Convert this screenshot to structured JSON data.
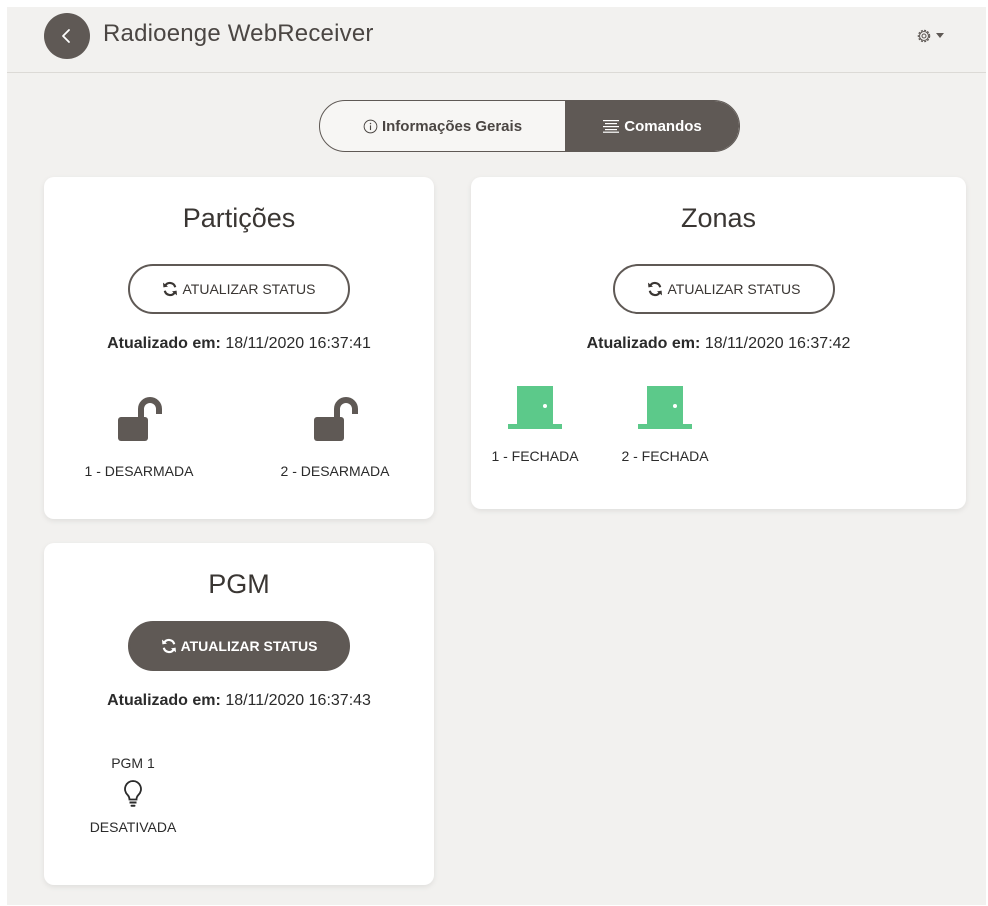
{
  "app": {
    "title": "Radioenge WebReceiver"
  },
  "tabs": [
    {
      "label": "Informações Gerais",
      "active": false
    },
    {
      "label": "Comandos",
      "active": true
    }
  ],
  "particoes": {
    "title": "Partições",
    "refresh_label": "ATUALIZAR STATUS",
    "updated_label": "Atualizado em:",
    "updated_value": "18/11/2020 16:37:41",
    "items": [
      {
        "label": "1 - DESARMADA",
        "icon": "lock-open-icon"
      },
      {
        "label": "2 - DESARMADA",
        "icon": "lock-open-icon"
      }
    ]
  },
  "zonas": {
    "title": "Zonas",
    "refresh_label": "ATUALIZAR STATUS",
    "updated_label": "Atualizado em:",
    "updated_value": "18/11/2020 16:37:42",
    "items": [
      {
        "label": "1 - FECHADA",
        "icon": "door-closed-icon"
      },
      {
        "label": "2 - FECHADA",
        "icon": "door-closed-icon"
      }
    ]
  },
  "pgm": {
    "title": "PGM",
    "refresh_label": "ATUALIZAR STATUS",
    "updated_label": "Atualizado em:",
    "updated_value": "18/11/2020 16:37:43",
    "items": [
      {
        "name": "PGM 1",
        "status": "DESATIVADA",
        "icon": "lightbulb-icon"
      }
    ]
  },
  "colors": {
    "primary": "#5f5955",
    "background": "#f2f1ef",
    "zone_closed": "#5cc98a"
  }
}
